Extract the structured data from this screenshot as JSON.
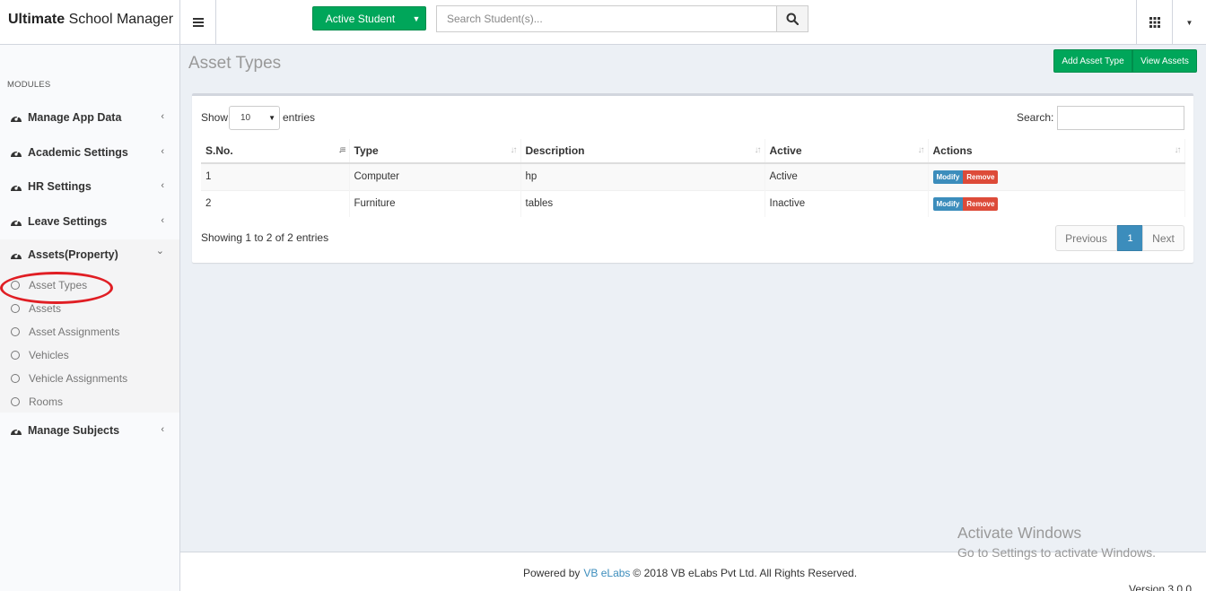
{
  "app": {
    "brand_bold": "Ultimate",
    "brand_rest": " School Manager"
  },
  "topbar": {
    "active_student_label": "Active Student",
    "search_placeholder": "Search Student(s)..."
  },
  "sidebar": {
    "header": "MODULES",
    "items": [
      {
        "label": "Manage App Data",
        "chevron": "‹"
      },
      {
        "label": "Academic Settings",
        "chevron": "‹"
      },
      {
        "label": "HR Settings",
        "chevron": "‹"
      },
      {
        "label": "Leave Settings",
        "chevron": "‹"
      },
      {
        "label": "Assets(Property)",
        "chevron": "⌄"
      },
      {
        "label": "Manage Subjects",
        "chevron": "‹"
      }
    ],
    "submenu": [
      {
        "label": "Asset Types"
      },
      {
        "label": "Assets"
      },
      {
        "label": "Asset Assignments"
      },
      {
        "label": "Vehicles"
      },
      {
        "label": "Vehicle Assignments"
      },
      {
        "label": "Rooms"
      }
    ]
  },
  "page": {
    "title": "Asset Types",
    "add_button": "Add Asset Type",
    "view_button": "View Assets"
  },
  "table": {
    "show_label": "Show",
    "page_length": "10",
    "entries_label": "entries",
    "search_label": "Search:",
    "columns": [
      "S.No.",
      "Type",
      "Description",
      "Active",
      "Actions"
    ],
    "rows": [
      {
        "sno": "1",
        "type": "Computer",
        "description": "hp",
        "active": "Active",
        "modify": "Modify",
        "remove": "Remove"
      },
      {
        "sno": "2",
        "type": "Furniture",
        "description": "tables",
        "active": "Inactive",
        "modify": "Modify",
        "remove": "Remove"
      }
    ],
    "info": "Showing 1 to 2 of 2 entries",
    "pagination": {
      "previous": "Previous",
      "current": "1",
      "next": "Next"
    }
  },
  "footer": {
    "powered_by": "Powered by",
    "link": "VB eLabs",
    "copyright": "© 2018 VB eLabs Pvt Ltd. All Rights Reserved.",
    "version": "Version 3.0.0"
  },
  "watermark": {
    "line1": "Activate Windows",
    "line2": "Go to Settings to activate Windows."
  },
  "colors": {
    "success": "#00a65a",
    "primary": "#3c8dbc",
    "danger": "#dd4b39",
    "annotation": "#e01e24"
  },
  "icons": {
    "menu": "hamburger-icon",
    "search": "search-icon",
    "apps": "grid-icon",
    "module": "dashboard-icon",
    "submenu": "circle-icon"
  }
}
